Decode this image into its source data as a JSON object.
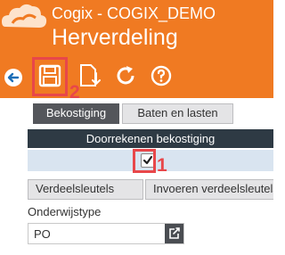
{
  "header": {
    "logo_icon": "cloud-logo-icon",
    "app_title": "Cogix - COGIX_DEMO",
    "page_title": "Herverdeling",
    "background": "#f07a22"
  },
  "toolbar": {
    "icons": [
      "back-icon",
      "save-icon",
      "export-icon",
      "refresh-icon",
      "help-icon"
    ]
  },
  "callouts": {
    "save": "2",
    "checkbox": "1",
    "color": "#e8474a"
  },
  "tabs": [
    {
      "label": "Bekostiging",
      "active": true
    },
    {
      "label": "Baten en lasten",
      "active": false
    }
  ],
  "table": {
    "header": "Doorrekenen bekostiging",
    "checkbox_checked": true
  },
  "subtabs": [
    {
      "label": "Verdeelsleutels"
    },
    {
      "label": "Invoeren verdeelsleutels"
    }
  ],
  "form": {
    "onderwijstype_label": "Onderwijstype",
    "onderwijstype_value": "PO"
  }
}
